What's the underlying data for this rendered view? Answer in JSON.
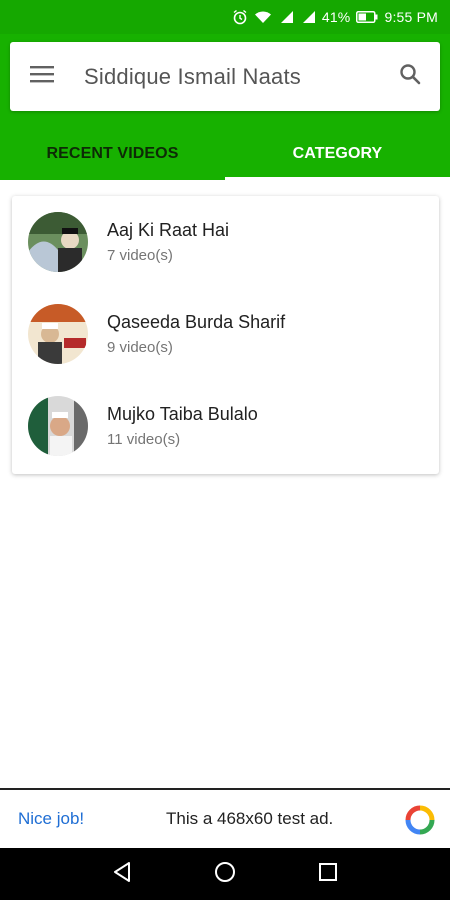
{
  "status_bar": {
    "battery_percent": "41%",
    "time": "9:55 PM",
    "icons": [
      "alarm-icon",
      "wifi-icon",
      "signal-icon",
      "signal-icon",
      "battery-icon"
    ]
  },
  "header": {
    "title": "Siddique Ismail Naats",
    "menu_icon": "hamburger-menu-icon",
    "search_icon": "search-icon",
    "accent_color": "#17b100"
  },
  "tabs": [
    {
      "label": "RECENT VIDEOS",
      "active": false
    },
    {
      "label": "CATEGORY",
      "active": true
    }
  ],
  "categories": [
    {
      "title": "Aaj Ki Raat Hai",
      "count": "7 video(s)"
    },
    {
      "title": "Qaseeda Burda Sharif",
      "count": "9 video(s)"
    },
    {
      "title": "Mujko Taiba Bulalo",
      "count": "11 video(s)"
    }
  ],
  "ad": {
    "label": "Nice job!",
    "text": "This a 468x60 test ad.",
    "logo_icon": "ad-logo-icon"
  },
  "nav_bar": {
    "icons": [
      "back-icon",
      "home-icon",
      "recents-icon"
    ]
  }
}
